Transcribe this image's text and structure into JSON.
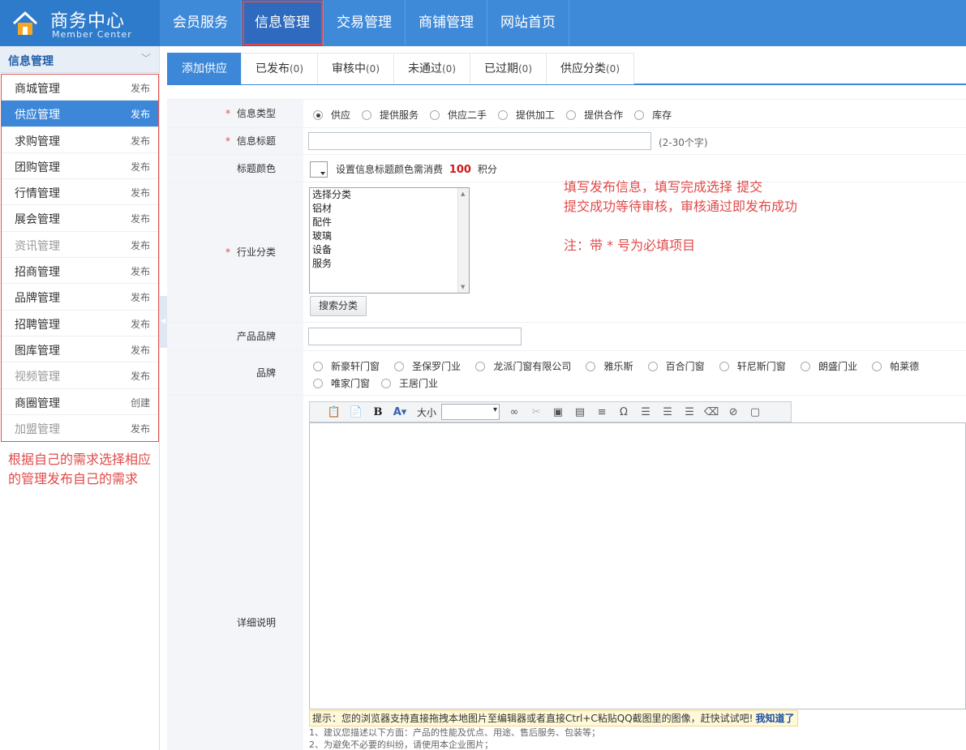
{
  "header": {
    "logo_title": "商务中心",
    "logo_subtitle": "Member Center",
    "nav": [
      {
        "label": "会员服务",
        "active": false
      },
      {
        "label": "信息管理",
        "active": true
      },
      {
        "label": "交易管理",
        "active": false
      },
      {
        "label": "商铺管理",
        "active": false
      },
      {
        "label": "网站首页",
        "active": false
      }
    ]
  },
  "sidebar": {
    "title": "信息管理",
    "items": [
      {
        "label": "商城管理",
        "action": "发布",
        "active": false,
        "dim": false
      },
      {
        "label": "供应管理",
        "action": "发布",
        "active": true,
        "dim": false
      },
      {
        "label": "求购管理",
        "action": "发布",
        "active": false,
        "dim": false
      },
      {
        "label": "团购管理",
        "action": "发布",
        "active": false,
        "dim": false
      },
      {
        "label": "行情管理",
        "action": "发布",
        "active": false,
        "dim": false
      },
      {
        "label": "展会管理",
        "action": "发布",
        "active": false,
        "dim": false
      },
      {
        "label": "资讯管理",
        "action": "发布",
        "active": false,
        "dim": true
      },
      {
        "label": "招商管理",
        "action": "发布",
        "active": false,
        "dim": false
      },
      {
        "label": "品牌管理",
        "action": "发布",
        "active": false,
        "dim": false
      },
      {
        "label": "招聘管理",
        "action": "发布",
        "active": false,
        "dim": false
      },
      {
        "label": "图库管理",
        "action": "发布",
        "active": false,
        "dim": false
      },
      {
        "label": "视频管理",
        "action": "发布",
        "active": false,
        "dim": true
      },
      {
        "label": "商圈管理",
        "action": "创建",
        "active": false,
        "dim": false
      },
      {
        "label": "加盟管理",
        "action": "发布",
        "active": false,
        "dim": true
      }
    ],
    "note": "根据自己的需求选择相应的管理发布自己的需求"
  },
  "tabs": [
    {
      "label": "添加供应",
      "count": "",
      "active": true
    },
    {
      "label": "已发布",
      "count": "(0)",
      "active": false
    },
    {
      "label": "审核中",
      "count": "(0)",
      "active": false
    },
    {
      "label": "未通过",
      "count": "(0)",
      "active": false
    },
    {
      "label": "已过期",
      "count": "(0)",
      "active": false
    },
    {
      "label": "供应分类",
      "count": "(0)",
      "active": false
    }
  ],
  "form": {
    "required_mark": "*",
    "info_type": {
      "label": "信息类型",
      "options": [
        "供应",
        "提供服务",
        "供应二手",
        "提供加工",
        "提供合作",
        "库存"
      ],
      "selected": 0
    },
    "info_title": {
      "label": "信息标题",
      "value": "",
      "hint": "(2-30个字)"
    },
    "title_color": {
      "label": "标题颜色",
      "text_before": "设置信息标题颜色需消费",
      "points": "100",
      "text_after": "积分"
    },
    "industry": {
      "label": "行业分类",
      "options": [
        "选择分类",
        "铝材",
        "配件",
        "玻璃",
        "设备",
        "服务"
      ],
      "search_button": "搜索分类"
    },
    "product_brand": {
      "label": "产品品牌",
      "value": ""
    },
    "brand": {
      "label": "品牌",
      "options": [
        "新豪轩门窗",
        "圣保罗门业",
        "龙派门窗有限公司",
        "雅乐斯",
        "百合门窗",
        "轩尼斯门窗",
        "朗盛门业",
        "帕莱德",
        "唯家门窗",
        "王居门业"
      ]
    },
    "detail": {
      "label": "详细说明",
      "toolbar_size_label": "大小",
      "tip": "提示：您的浏览器支持直接拖拽本地图片至编辑器或者直接Ctrl+C粘贴QQ截图里的图像，赶快试试吧!",
      "tip_ok": "我知道了",
      "advice": [
        "1、建议您描述以下方面：产品的性能及优点、用途、售后服务、包装等；",
        "2、为避免不必要的纠纷，请使用本企业图片；"
      ]
    }
  },
  "annotations": {
    "line1": "填写发布信息，填写完成选择 提交",
    "line2": "提交成功等待审核，审核通过即发布成功",
    "line3": "注：带 * 号为必填项目"
  },
  "colors": {
    "header": "#3e8ad9",
    "active_blue": "#3c87d8",
    "annotation_red": "#e04a4a"
  }
}
